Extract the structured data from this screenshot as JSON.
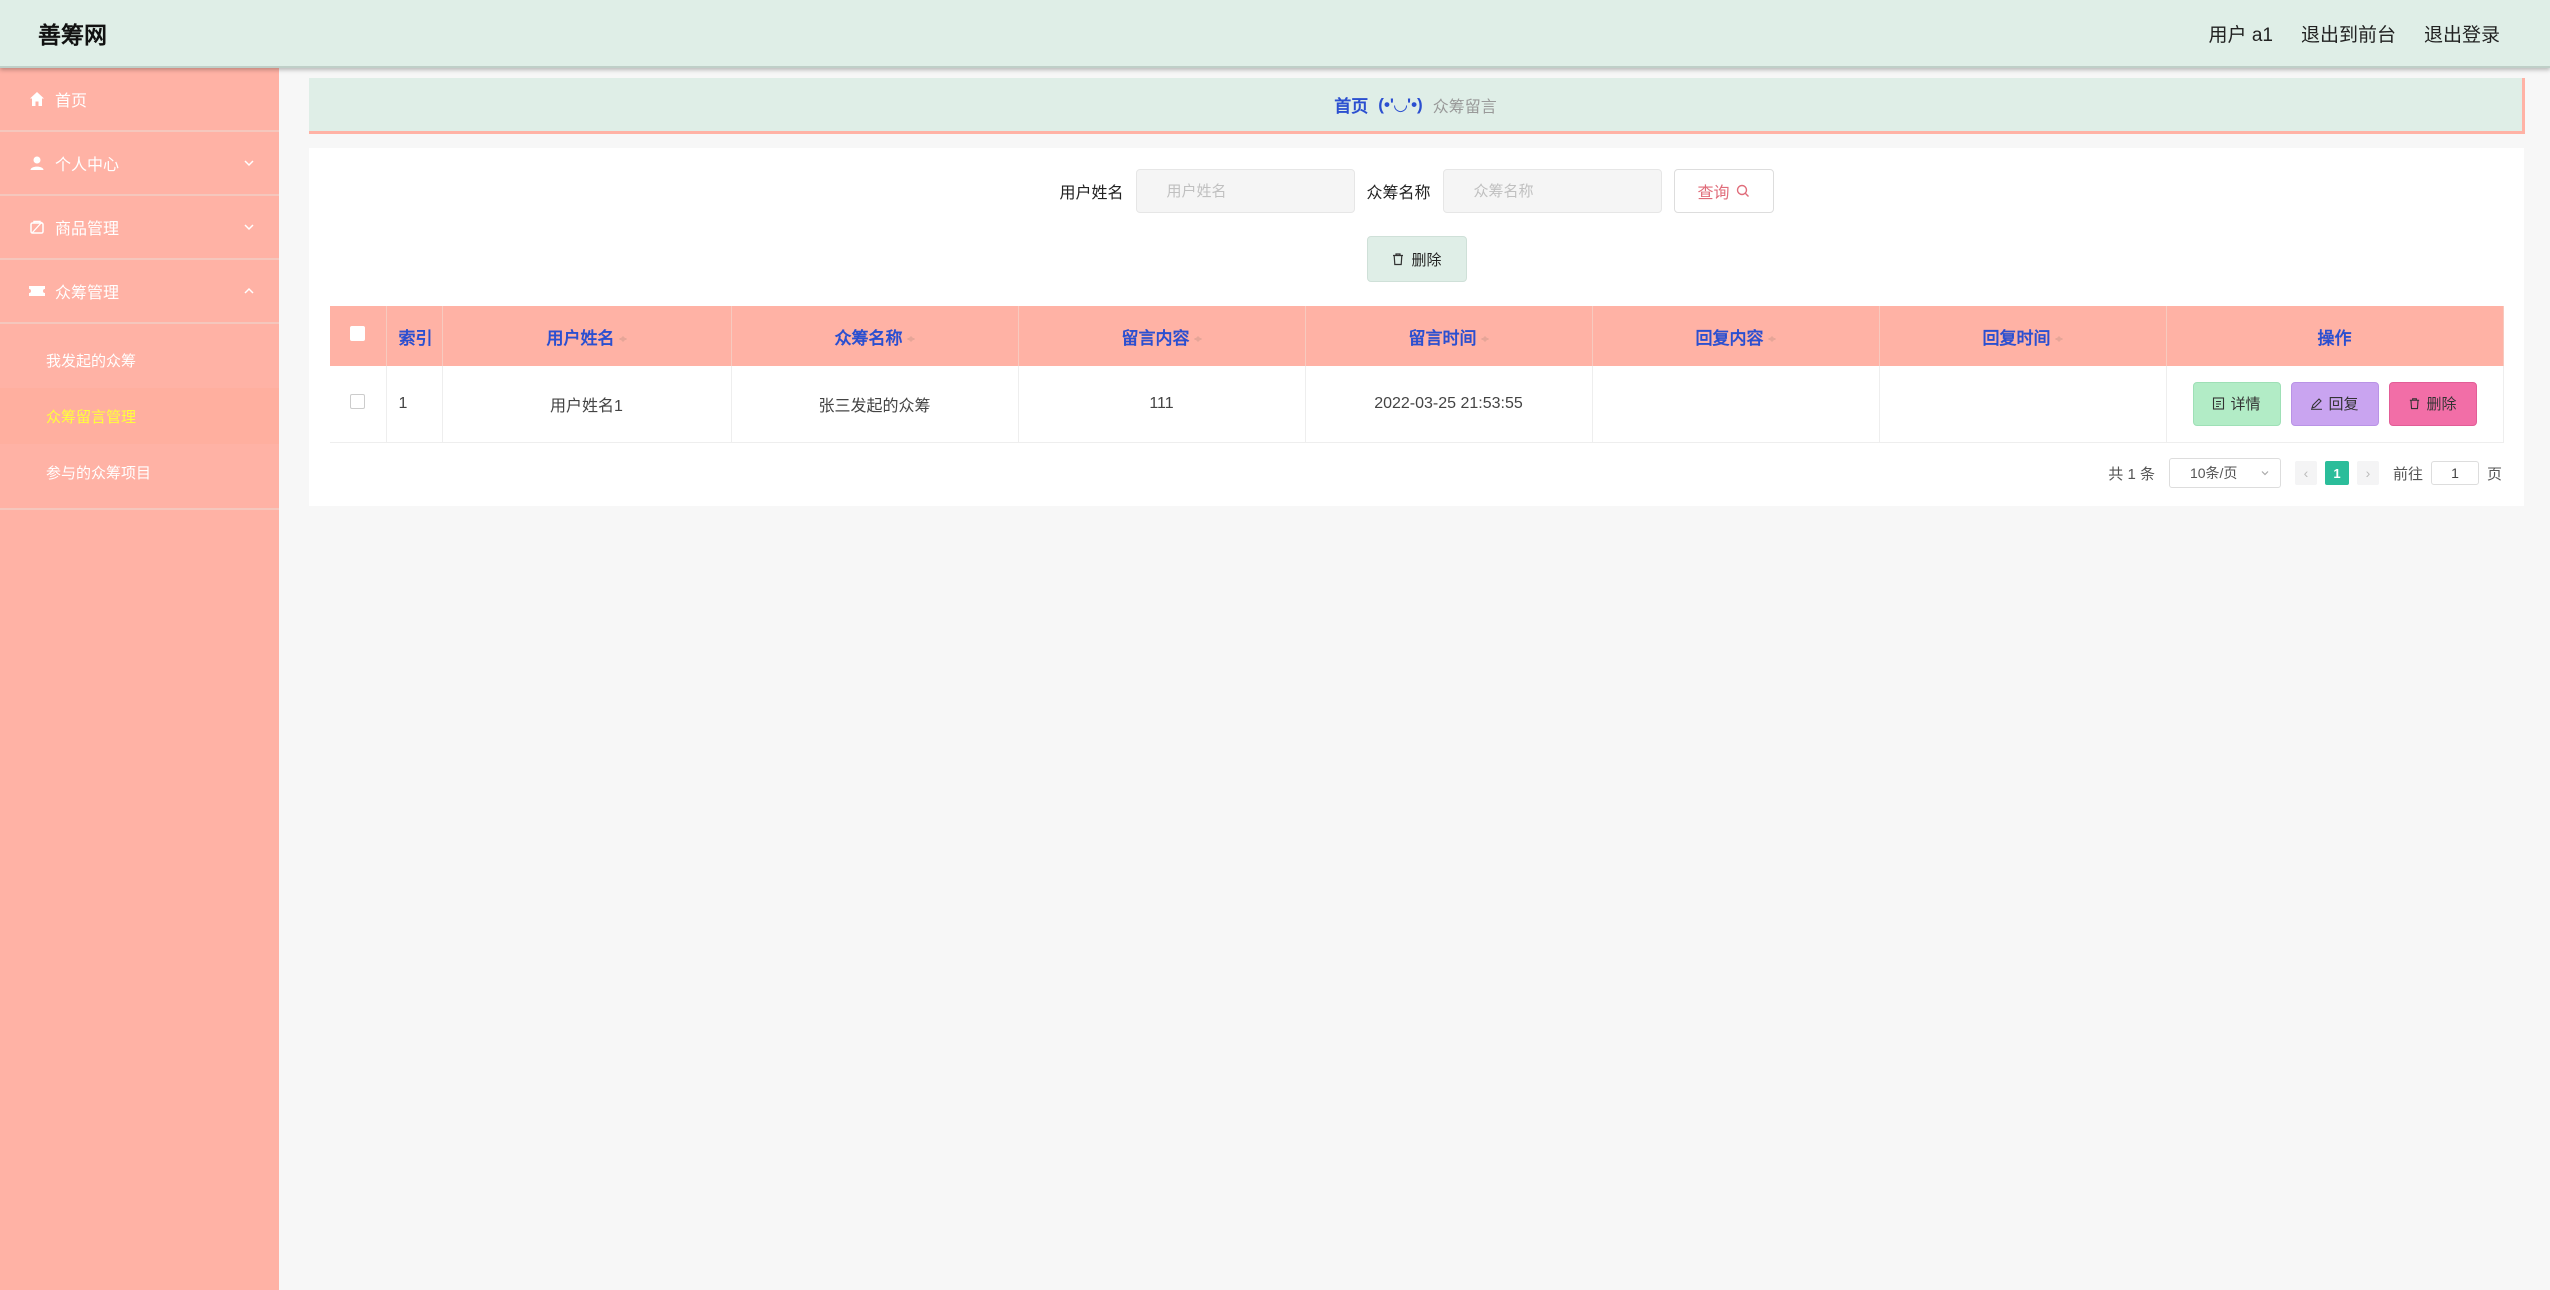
{
  "app": {
    "title": "善筹网"
  },
  "topbar": {
    "user": "用户 a1",
    "back_front": "退出到前台",
    "logout": "退出登录"
  },
  "sidebar": {
    "items": [
      {
        "label": "首页",
        "icon": "home-icon"
      },
      {
        "label": "个人中心",
        "icon": "user-icon",
        "expandable": true
      },
      {
        "label": "商品管理",
        "icon": "goods-icon",
        "expandable": true
      },
      {
        "label": "众筹管理",
        "icon": "ticket-icon",
        "expanded": true,
        "children": [
          {
            "label": "我发起的众筹"
          },
          {
            "label": "众筹留言管理",
            "active": true
          },
          {
            "label": "参与的众筹项目"
          }
        ]
      }
    ]
  },
  "breadcrumb": {
    "home": "首页",
    "separator": "(•'◡'•)",
    "current": "众筹留言"
  },
  "search": {
    "username_label": "用户姓名",
    "username_placeholder": "用户姓名",
    "crowdfund_label": "众筹名称",
    "crowdfund_placeholder": "众筹名称",
    "query_label": "查询"
  },
  "toolbar": {
    "delete_label": "删除"
  },
  "table": {
    "columns": [
      "索引",
      "用户姓名",
      "众筹名称",
      "留言内容",
      "留言时间",
      "回复内容",
      "回复时间",
      "操作"
    ],
    "rows": [
      {
        "index": "1",
        "username": "用户姓名1",
        "crowdfund": "张三发起的众筹",
        "content": "111",
        "time": "2022-03-25 21:53:55",
        "reply": "",
        "reply_time": ""
      }
    ],
    "actions": {
      "detail": "详情",
      "reply": "回复",
      "delete": "删除"
    }
  },
  "pagination": {
    "total": "共 1 条",
    "page_size": "10条/页",
    "current_page": "1",
    "goto_label": "前往",
    "goto_value": "1",
    "page_suffix": "页"
  },
  "colors": {
    "accent": "#ffb2a5",
    "header_bg": "#dfeee7",
    "link_blue": "#2b4fd0",
    "active_menu": "#ffff3a",
    "page_active": "#2bbd9a"
  }
}
